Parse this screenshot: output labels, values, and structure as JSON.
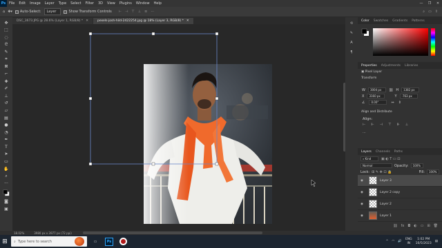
{
  "app": {
    "logo": "Ps",
    "menu": [
      "File",
      "Edit",
      "Image",
      "Layer",
      "Type",
      "Select",
      "Filter",
      "3D",
      "View",
      "Plugins",
      "Window",
      "Help"
    ],
    "window_controls": [
      "—",
      "❐",
      "✕"
    ]
  },
  "options": {
    "auto_select_label": "Auto-Select:",
    "auto_select_value": "Layer",
    "show_transform_label": "Show Transform Controls"
  },
  "tabs": [
    {
      "label": "DSC_3673.JPG @ 28.6% (Layer 1, RGB/8) *",
      "close": "✕",
      "active": false
    },
    {
      "label": "pexels-josh-hild-2422254.jpg @ 18% (Layer 3, RGB/8) *",
      "close": "✕",
      "active": true
    }
  ],
  "status": {
    "zoom": "18.02%",
    "doc_info": "3980 px x 3977 px (72 ppi)"
  },
  "color_panel": {
    "tabs": [
      "Color",
      "Swatches",
      "Gradients",
      "Patterns"
    ],
    "active_tab": "Color",
    "hue_color": "#ff0000"
  },
  "properties_panel": {
    "tabs": [
      "Properties",
      "Adjustments",
      "Libraries"
    ],
    "active_tab": "Properties",
    "layer_type": "Pixel Layer",
    "transform_label": "Transform",
    "w_label": "W",
    "w_value": "3004 px",
    "h_label": "H",
    "h_value": "1382 px",
    "x_label": "X",
    "x_value": "3160 px",
    "y_label": "Y",
    "y_value": "-763 px",
    "angle_value": "0.00°",
    "align_label": "Align and Distribute",
    "align_sub": "Align:"
  },
  "layers_panel": {
    "tabs": [
      "Layers",
      "Channels",
      "Paths"
    ],
    "active_tab": "Layers",
    "kind_label": "Kind",
    "blend_mode": "Normal",
    "opacity_label": "Opacity:",
    "opacity_value": "100%",
    "lock_label": "Lock:",
    "fill_label": "Fill:",
    "fill_value": "100%",
    "layers": [
      {
        "name": "Layer 3",
        "selected": true,
        "visible": true
      },
      {
        "name": "Layer 2 copy",
        "selected": false,
        "visible": true
      },
      {
        "name": "Layer 2",
        "selected": false,
        "visible": true
      },
      {
        "name": "Layer 1",
        "selected": false,
        "visible": true
      }
    ]
  },
  "taskbar": {
    "search_placeholder": "Type here to search",
    "language": "ENG",
    "region": "IN",
    "time": "1:02 PM",
    "date": "10/5/2023"
  }
}
